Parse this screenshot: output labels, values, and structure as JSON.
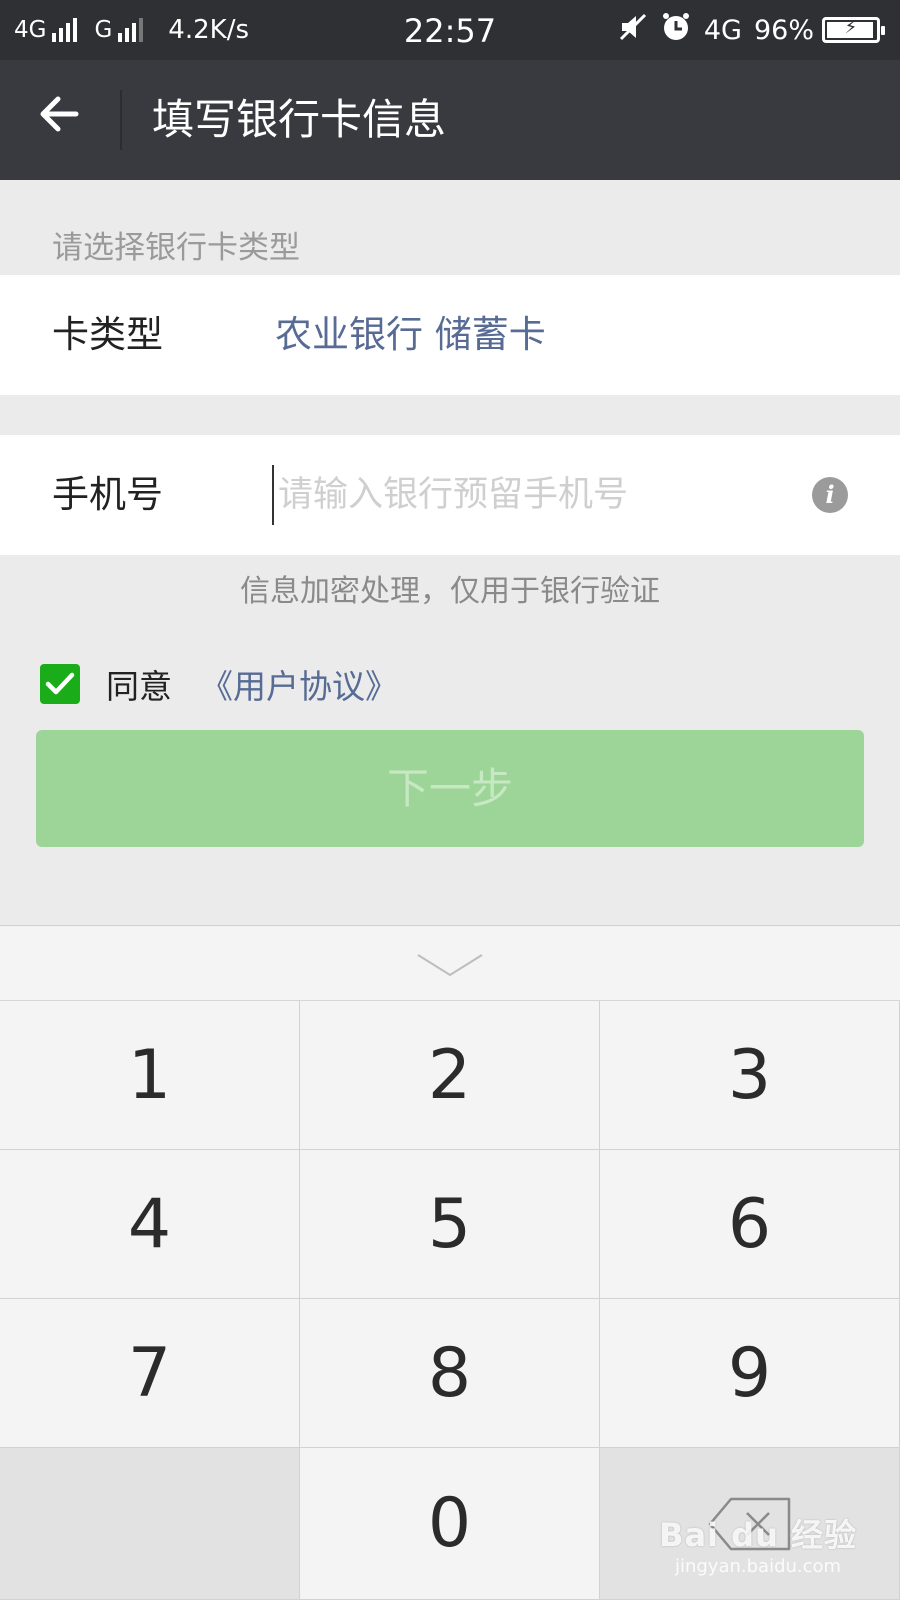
{
  "status_bar": {
    "network1": "4G",
    "network2": "G",
    "speed": "4.2K/s",
    "time": "22:57",
    "network3": "4G",
    "battery": "96%",
    "battery_level": 0.96
  },
  "header": {
    "title": "填写银行卡信息"
  },
  "form": {
    "section_label": "请选择银行卡类型",
    "card_type_label": "卡类型",
    "card_type_value": "农业银行 储蓄卡",
    "phone_label": "手机号",
    "phone_value": "",
    "phone_placeholder": "请输入银行预留手机号",
    "hint": "信息加密处理，仅用于银行验证",
    "agree_text": "同意",
    "agree_link": "《用户协议》",
    "agree_checked": true,
    "next_button": "下一步"
  },
  "keyboard": {
    "keys": [
      "1",
      "2",
      "3",
      "4",
      "5",
      "6",
      "7",
      "8",
      "9",
      "0"
    ]
  },
  "watermark": {
    "brand": "Bai du 经验",
    "url": "jingyan.baidu.com"
  },
  "colors": {
    "header_bg": "#393a3f",
    "link": "#576b95",
    "check_green": "#1aad19",
    "button_disabled": "#9dd598"
  }
}
